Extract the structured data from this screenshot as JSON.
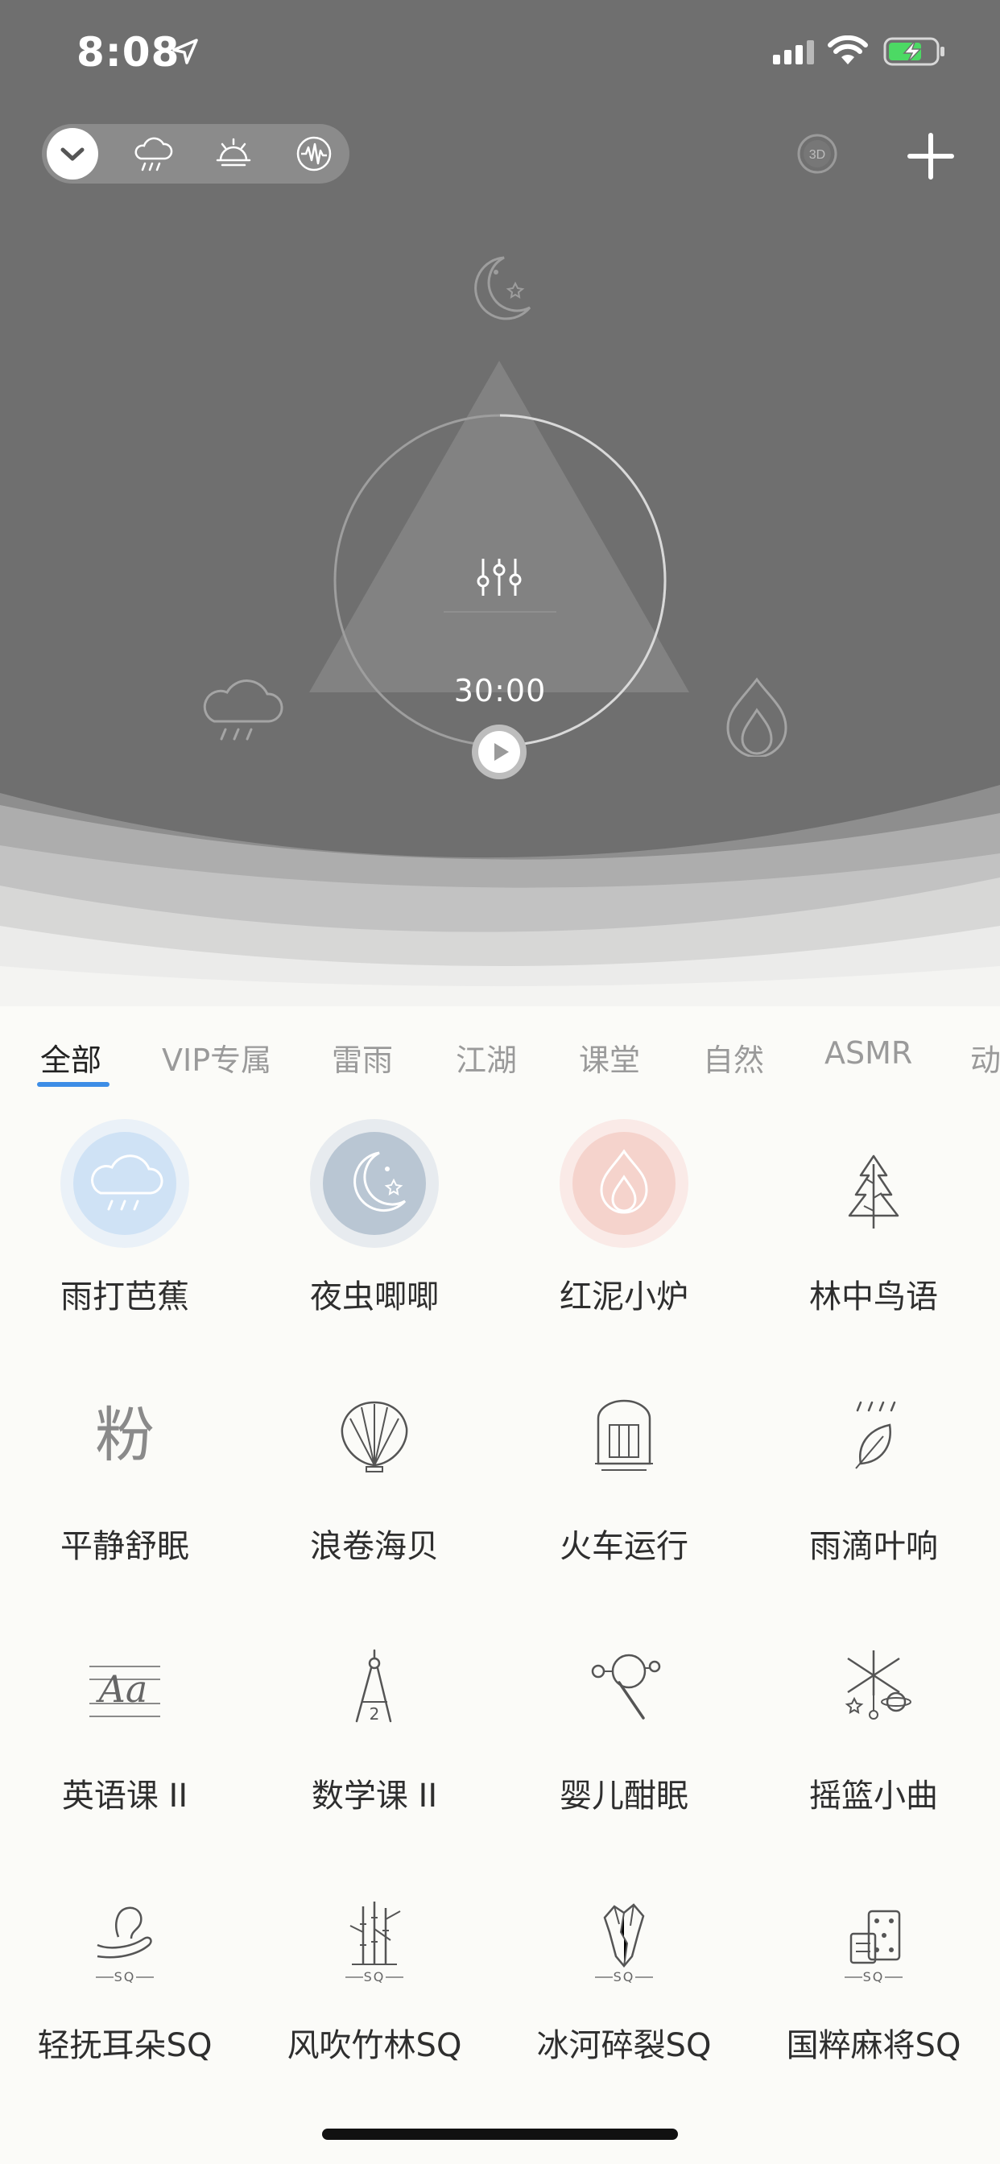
{
  "status_bar": {
    "time": "8:08"
  },
  "sound_modes": [
    {
      "icon": "chevron-down-icon",
      "active": true
    },
    {
      "icon": "rain-cloud-icon",
      "active": false
    },
    {
      "icon": "sunrise-icon",
      "active": false
    },
    {
      "icon": "soundwave-icon",
      "active": false
    }
  ],
  "header": {
    "mode_3d_label": "3D"
  },
  "player": {
    "timer": "30:00"
  },
  "mixer_sounds": [
    {
      "icon": "moon-stars-icon"
    },
    {
      "icon": "rain-cloud-icon"
    },
    {
      "icon": "flame-icon"
    }
  ],
  "categories": [
    "全部",
    "VIP专属",
    "雷雨",
    "江湖",
    "课堂",
    "自然",
    "ASMR",
    "动"
  ],
  "active_category": 0,
  "sounds": [
    {
      "label": "雨打芭蕉",
      "icon": "rain-cloud-icon",
      "selected": true,
      "color": "#cfe2f5"
    },
    {
      "label": "夜虫唧唧",
      "icon": "moon-stars-icon",
      "selected": true,
      "color": "#b9c6d3"
    },
    {
      "label": "红泥小炉",
      "icon": "flame-icon",
      "selected": true,
      "color": "#f5d3cc"
    },
    {
      "label": "林中鸟语",
      "icon": "tree-icon",
      "selected": false
    },
    {
      "label": "平静舒眠",
      "icon": "fen-character-icon",
      "glyph": "粉",
      "selected": false
    },
    {
      "label": "浪卷海贝",
      "icon": "seashell-icon",
      "selected": false
    },
    {
      "label": "火车运行",
      "icon": "train-icon",
      "selected": false
    },
    {
      "label": "雨滴叶响",
      "icon": "rain-leaf-icon",
      "selected": false
    },
    {
      "label": "英语课 II",
      "icon": "english-aa-icon",
      "glyph": "Aa",
      "selected": false
    },
    {
      "label": "数学课 II",
      "icon": "compass-icon",
      "selected": false
    },
    {
      "label": "婴儿酣眠",
      "icon": "rattle-icon",
      "selected": false
    },
    {
      "label": "摇篮小曲",
      "icon": "baby-mobile-icon",
      "selected": false
    },
    {
      "label": "轻抚耳朵SQ",
      "icon": "ear-hand-icon",
      "badge": "SQ",
      "selected": false
    },
    {
      "label": "风吹竹林SQ",
      "icon": "bamboo-icon",
      "badge": "SQ",
      "selected": false
    },
    {
      "label": "冰河碎裂SQ",
      "icon": "glacier-icon",
      "badge": "SQ",
      "selected": false
    },
    {
      "label": "国粹麻将SQ",
      "icon": "mahjong-icon",
      "badge": "SQ",
      "selected": false
    }
  ]
}
